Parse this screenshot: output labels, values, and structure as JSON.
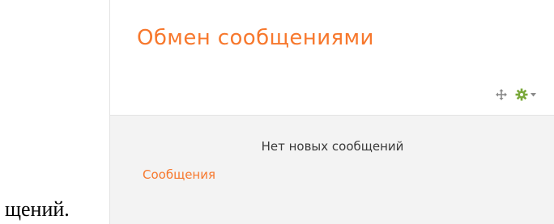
{
  "document": {
    "text_before": "",
    "text_after": "щений."
  },
  "block": {
    "title": "Обмен сообщениями",
    "controls": {
      "move_icon": "move-arrows-icon",
      "settings_icon": "gear-icon",
      "dropdown_icon": "caret-down-icon",
      "icon_color": "#7aa83a"
    },
    "empty_message": "Нет новых сообщений",
    "messages_link": "Сообщения"
  },
  "colors": {
    "accent": "#f7782d",
    "content_bg": "#f3f3f3",
    "border": "#e3e3e3"
  }
}
